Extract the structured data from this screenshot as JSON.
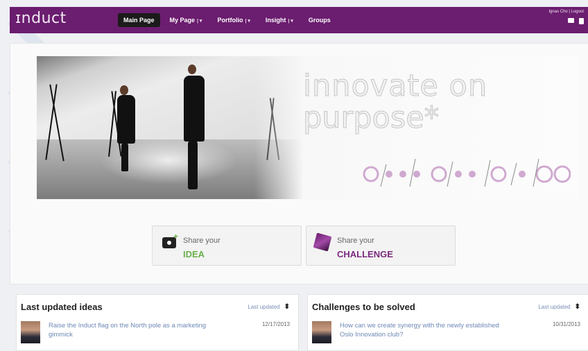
{
  "header": {
    "logo": "ɪnduct",
    "nav": [
      {
        "label": "Main Page",
        "active": true,
        "dropdown": false
      },
      {
        "label": "My Page",
        "active": false,
        "dropdown": true
      },
      {
        "label": "Portfolio",
        "active": false,
        "dropdown": true
      },
      {
        "label": "Insight",
        "active": false,
        "dropdown": true
      },
      {
        "label": "Groups",
        "active": false,
        "dropdown": false
      }
    ],
    "user_link": "Ignas Cho | Logout",
    "dropdown_glyph": "| ▾"
  },
  "banner": {
    "tagline_line1": "innovate on",
    "tagline_line2": "purpose*"
  },
  "share": {
    "idea": {
      "line1": "Share your",
      "line2": "IDEA",
      "color": "#6ab04c"
    },
    "challenge": {
      "line1": "Share your",
      "line2": "CHALLENGE",
      "color": "#7a2b7e"
    }
  },
  "panels": {
    "ideas": {
      "title": "Last updated ideas",
      "sort_label": "Last updated",
      "sort_glyph": "⬍",
      "item_text": "Raise the Induct flag on the North pole as a marketing gimmick",
      "item_date": "12/17/2013"
    },
    "challenges": {
      "title": "Challenges to be solved",
      "sort_label": "Last updated",
      "sort_glyph": "⬍",
      "item_text": "How can we create synergy with the newly established Oslo Innovation club?",
      "item_date": "10/31/2013"
    }
  },
  "colors": {
    "brand": "#6b1d6f",
    "link": "#6d88b4"
  }
}
